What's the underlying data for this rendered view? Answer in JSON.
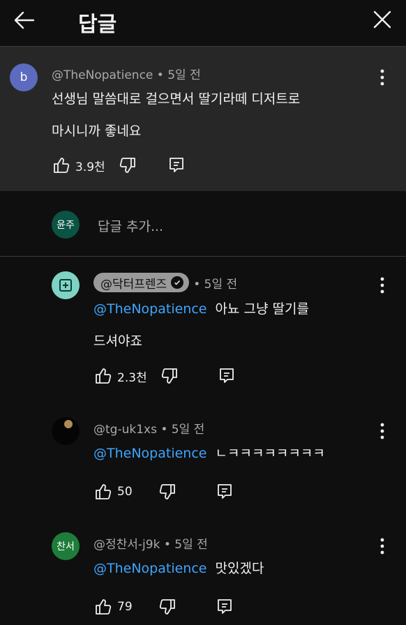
{
  "header": {
    "title": "답글",
    "back_icon": "arrow-left-icon",
    "close_icon": "close-icon"
  },
  "main_comment": {
    "avatar_letter": "b",
    "avatar_color": "#5c6bc0",
    "author": "@TheNopatience",
    "time": "• 5일 전",
    "text_line1": "선생님 말씀대로 걸으면서 딸기라떼 디저트로",
    "text_line2": "마시니까 좋네요",
    "likes": "3.9천"
  },
  "add_reply": {
    "avatar_text": "윤주",
    "avatar_color": "#0b5345",
    "placeholder": "답글 추가..."
  },
  "replies": [
    {
      "avatar_color": "#7fd3c4",
      "author": "@닥터프렌즈",
      "verified": true,
      "time": "• 5일 전",
      "mention": "@TheNopatience",
      "text_line1": "아뇨 그냥 딸기를",
      "text_line2": "드셔야죠",
      "likes": "2.3천"
    },
    {
      "avatar_color": "#1a1a1a",
      "author": "@tg-uk1xs",
      "time": "• 5일 전",
      "mention": "@TheNopatience",
      "text_line1": "ㄴㅋㅋㅋㅋㅋㅋㅋㅋ",
      "likes": "50"
    },
    {
      "avatar_text": "찬서",
      "avatar_color": "#1e7d3a",
      "author": "@정찬서-j9k",
      "time": "• 5일 전",
      "mention": "@TheNopatience",
      "text_line1": "맛있겠다",
      "likes": "79"
    }
  ]
}
